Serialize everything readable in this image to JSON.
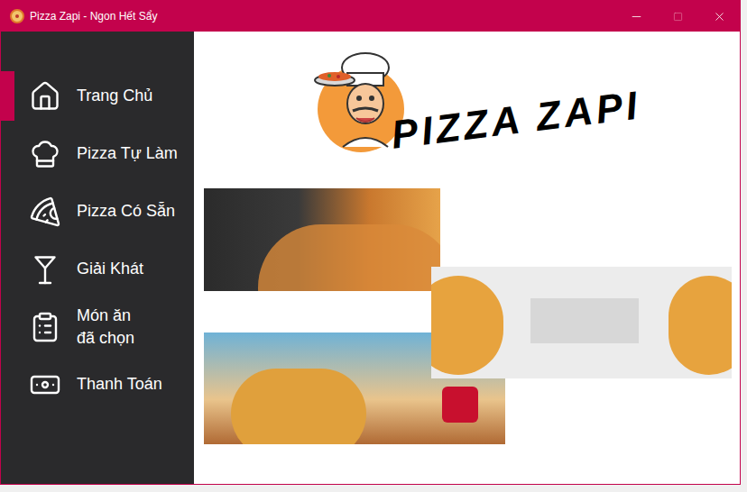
{
  "window": {
    "title": "Pizza Zapi - Ngon Hết Sẩy",
    "controls": [
      {
        "name": "minimize",
        "disabled": false
      },
      {
        "name": "maximize",
        "disabled": true
      },
      {
        "name": "close",
        "disabled": false
      }
    ]
  },
  "sidebar": {
    "items": [
      {
        "label": "Trang Chủ",
        "selected": true
      },
      {
        "label": "Pizza Tự Làm",
        "selected": false
      },
      {
        "label": "Pizza Có Sẵn",
        "selected": false
      },
      {
        "label": "Giải Khát",
        "selected": false
      },
      {
        "label": "Món ăn\nđã chọn",
        "selected": false
      },
      {
        "label": "Thanh Toán",
        "selected": false
      }
    ]
  },
  "logo": {
    "text": "PIZZA ZAPI"
  }
}
